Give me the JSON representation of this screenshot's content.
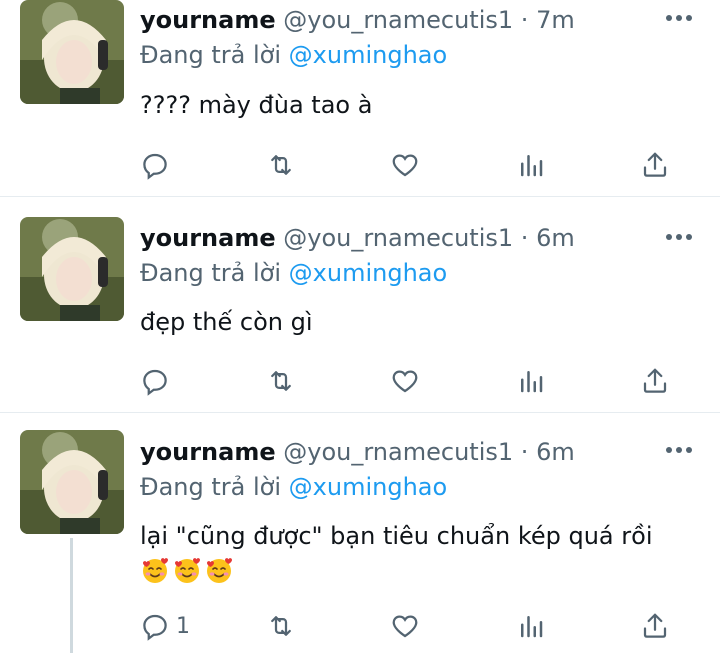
{
  "tweets": [
    {
      "name": "yourname",
      "handle": "@you_rnamecutis1",
      "dot": "·",
      "time": "7m",
      "reply_prefix": "Đang trả lời",
      "reply_to": "@xuminghao",
      "text": "???? mày đùa tao à",
      "emoji_count": 0,
      "reply_count": ""
    },
    {
      "name": "yourname",
      "handle": "@you_rnamecutis1",
      "dot": "·",
      "time": "6m",
      "reply_prefix": "Đang trả lời",
      "reply_to": "@xuminghao",
      "text": "đẹp thế còn gì",
      "emoji_count": 0,
      "reply_count": ""
    },
    {
      "name": "yourname",
      "handle": "@you_rnamecutis1",
      "dot": "·",
      "time": "6m",
      "reply_prefix": "Đang trả lời",
      "reply_to": "@xuminghao",
      "text": "lại \"cũng được\" bạn tiêu chuẩn kép quá rồi",
      "emoji_count": 3,
      "reply_count": "1"
    }
  ],
  "icons": {
    "reply": "reply-icon",
    "retweet": "retweet-icon",
    "like": "heart-icon",
    "views": "views-icon",
    "share": "share-icon",
    "more": "more-icon",
    "emoji": "smiling-face-with-hearts-icon"
  },
  "colors": {
    "text": "#0f1419",
    "secondary": "#536471",
    "link": "#1d9bf0",
    "separator": "#e6ecf0"
  }
}
